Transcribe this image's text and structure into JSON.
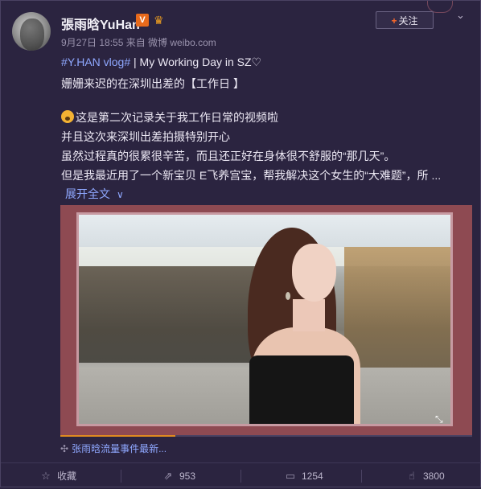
{
  "author": {
    "name": "張雨晗YuHan",
    "verified_badge": "V"
  },
  "meta_line": "9月27日 18:55 来自 微博 weibo.com",
  "follow_button": {
    "plus": "+",
    "label": "关注"
  },
  "post": {
    "hashtag": "#Y.HAN vlog#",
    "title_rest": " | My Working Day in SZ♡",
    "line2": "姗姗来迟的在深圳出差的【工作日 】",
    "line3": "这是第二次记录关于我工作日常的视频啦",
    "line4": "并且这次来深圳出差拍摄特别开心",
    "line5": "虽然过程真的很累很辛苦，而且还正好在身体很不舒服的“那几天”。",
    "line6": "但是我最近用了一个新宝贝 E飞养宫宝，帮我解决这个女生的“大难题”，所 ..."
  },
  "expand_label": "展开全文",
  "video": {
    "progress": 0.28
  },
  "ext_link_label": "张雨晗流量事件最新...",
  "actions": {
    "collect": "收藏",
    "repost": "953",
    "comment": "1254",
    "like": "3800"
  },
  "colors": {
    "background": "#2b2440",
    "link": "#8fa8ff",
    "accent": "#e08a20"
  }
}
